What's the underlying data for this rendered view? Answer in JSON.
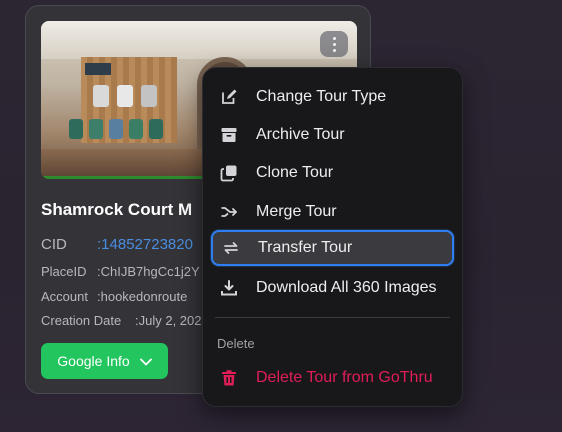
{
  "card": {
    "title": "Shamrock Court M",
    "cid_label": "CID",
    "cid_value": ":14852723820",
    "placeid_label": "PlaceID",
    "placeid_value": ":ChIJB7hgCc1j2Y",
    "account_label": "Account",
    "account_value": ":hookedonroute",
    "created_label": "Creation Date",
    "created_value": ":July 2, 202",
    "google_button": "Google Info"
  },
  "menu": {
    "items": [
      {
        "label": "Change Tour Type",
        "icon": "edit-icon"
      },
      {
        "label": "Archive Tour",
        "icon": "archive-icon"
      },
      {
        "label": "Clone Tour",
        "icon": "copy-icon"
      },
      {
        "label": "Merge Tour",
        "icon": "merge-icon"
      },
      {
        "label": "Transfer Tour",
        "icon": "transfer-icon",
        "active": true
      },
      {
        "label": "Download All 360 Images",
        "icon": "download-icon"
      }
    ],
    "section_label": "Delete",
    "delete_item": {
      "label": "Delete Tour from GoThru",
      "icon": "trash-icon"
    }
  },
  "colors": {
    "accent_green": "#22c55e",
    "link_blue": "#4a8ee0",
    "focus_blue": "#2f7ef0",
    "danger": "#e11d57"
  }
}
